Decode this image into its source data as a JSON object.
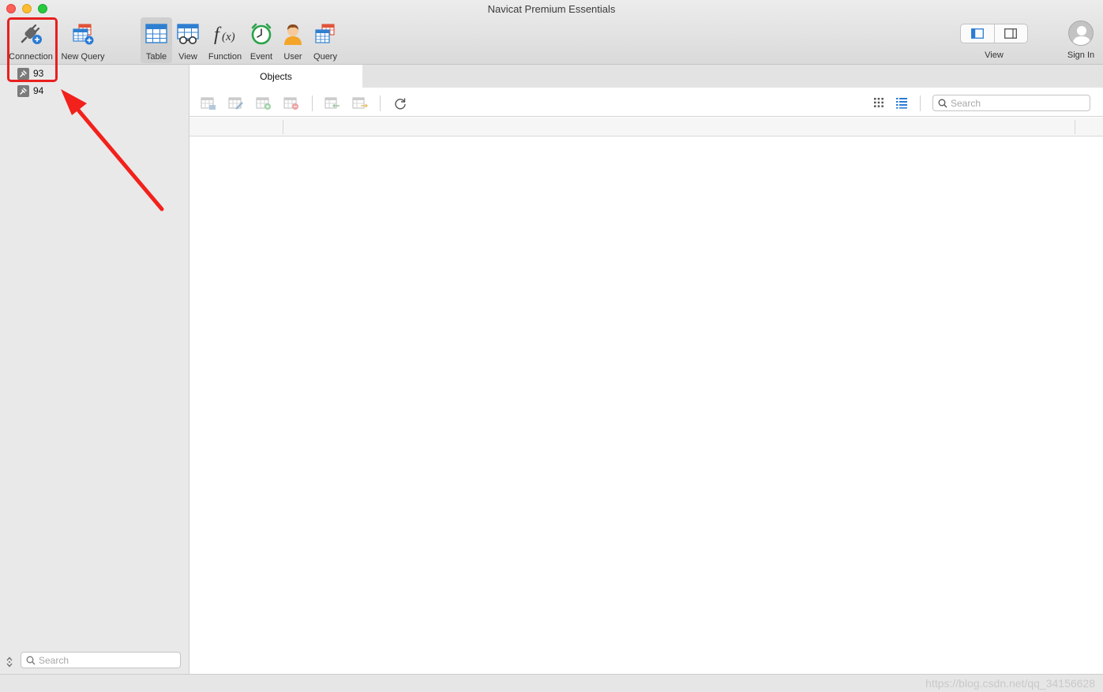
{
  "window": {
    "title": "Navicat Premium Essentials"
  },
  "toolbar": {
    "connection_label": "Connection",
    "new_query_label": "New Query",
    "table_label": "Table",
    "view_label": "View",
    "function_label": "Function",
    "event_label": "Event",
    "user_label": "User",
    "query_label": "Query",
    "view_toggle_label": "View",
    "sign_in_label": "Sign In",
    "active_item": "Table"
  },
  "sidebar": {
    "connections": [
      {
        "label": "93"
      },
      {
        "label": "94"
      }
    ],
    "search_placeholder": "Search"
  },
  "main": {
    "tab_label": "Objects",
    "search_placeholder": "Search",
    "action_icons": [
      "open-table-icon",
      "design-table-icon",
      "new-table-icon",
      "delete-table-icon",
      "import-wizard-icon",
      "export-wizard-icon",
      "refresh-icon",
      "grid-view-icon",
      "list-view-icon"
    ]
  },
  "statusbar": {
    "watermark": "https://blog.csdn.net/qq_34156628"
  },
  "annotation": {
    "box_color": "#e8201e",
    "arrow_color": "#f2211b"
  },
  "colors": {
    "accent_blue": "#2a7bd5",
    "table_icon_blue": "#2f7fd1",
    "query_icon_red": "#e0543a"
  }
}
